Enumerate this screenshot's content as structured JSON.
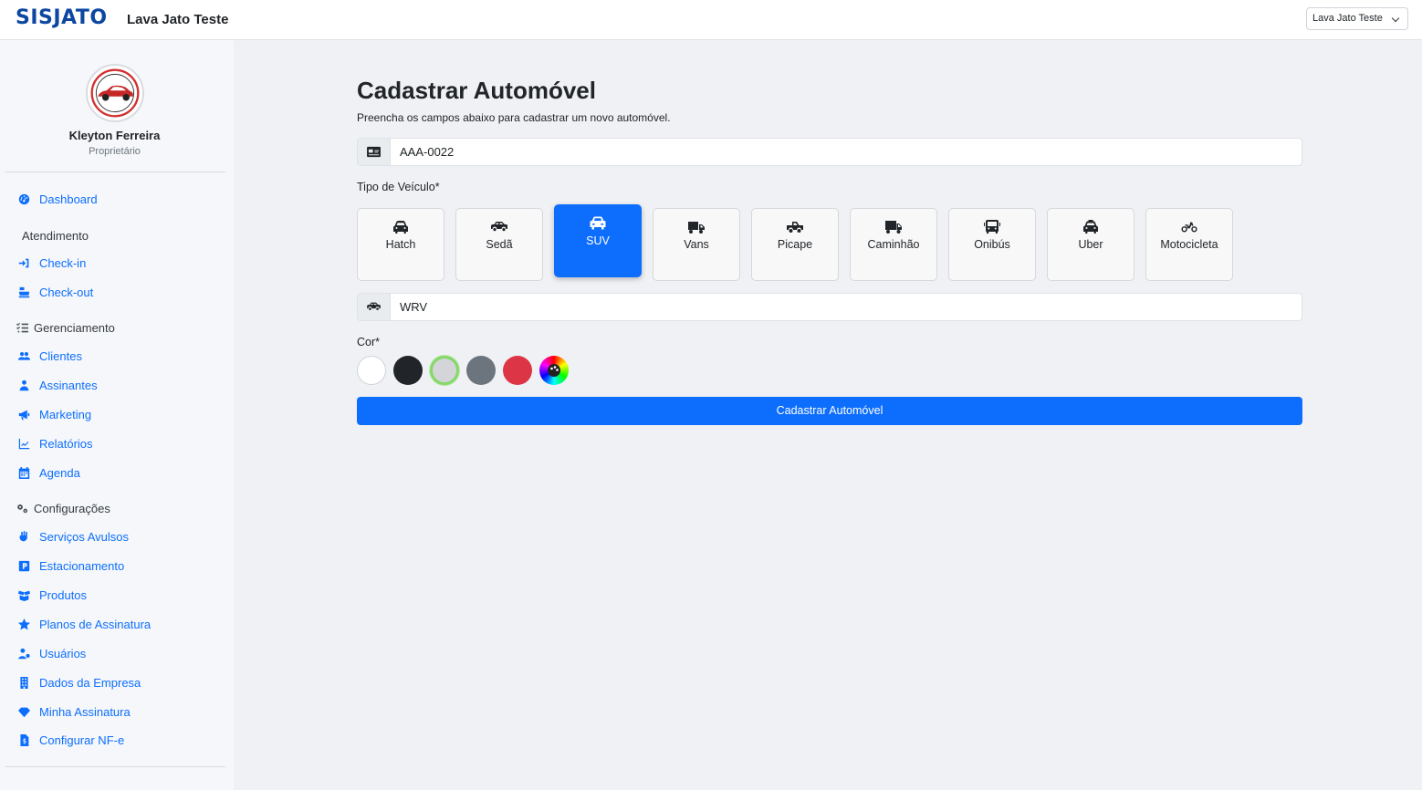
{
  "header": {
    "brand": "SISJATO",
    "company_title": "Lava Jato Teste",
    "company_select": "Lava Jato Teste"
  },
  "user": {
    "name": "Kleyton Ferreira",
    "role": "Proprietário"
  },
  "sidebar": {
    "dashboard": "Dashboard",
    "atendimento_title": "Atendimento",
    "checkin": "Check-in",
    "checkout": "Check-out",
    "gerenciamento_title": "Gerenciamento",
    "clientes": "Clientes",
    "assinantes": "Assinantes",
    "marketing": "Marketing",
    "relatorios": "Relatórios",
    "agenda": "Agenda",
    "configuracoes_title": "Configurações",
    "servicos": "Serviços Avulsos",
    "estacionamento": "Estacionamento",
    "produtos": "Produtos",
    "planos": "Planos de Assinatura",
    "usuarios": "Usuários",
    "dados_empresa": "Dados da Empresa",
    "minha_assinatura": "Minha Assinatura",
    "configurar_nfe": "Configurar NF-e"
  },
  "form": {
    "title": "Cadastrar Automóvel",
    "subtitle": "Preencha os campos abaixo para cadastrar um novo automóvel.",
    "plate_value": "AAA-0022",
    "type_label": "Tipo de Veículo*",
    "types": [
      "Hatch",
      "Sedã",
      "SUV",
      "Vans",
      "Picape",
      "Caminhão",
      "Onibús",
      "Uber",
      "Motocicleta"
    ],
    "selected_type": "SUV",
    "model_value": "WRV",
    "color_label": "Cor*",
    "colors": [
      "#ffffff",
      "#212529",
      "#d3d5d8",
      "#6c757d",
      "#dc3545",
      "custom-color-picker"
    ],
    "selected_color": "#d3d5d8",
    "submit": "Cadastrar Automóvel"
  }
}
